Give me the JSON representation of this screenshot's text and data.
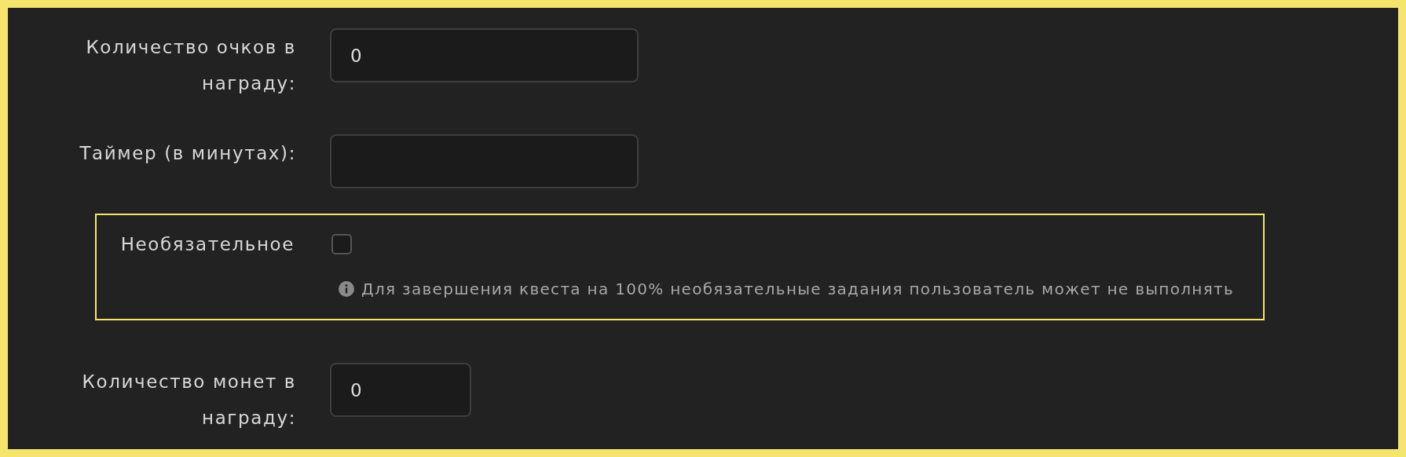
{
  "fields": [
    {
      "kind": "text",
      "label": "Количество очков в награду:",
      "value": "0"
    },
    {
      "kind": "text",
      "label": "Таймер (в минутах):"
    },
    {
      "kind": "checkbox",
      "label": "Необязательное",
      "checked": false,
      "highlighted": true,
      "hint": "Для завершения квеста на 100% необязательные задания пользователь может не выполнять"
    },
    {
      "kind": "short",
      "label": "Количество монет в награду:",
      "value": "0"
    }
  ]
}
